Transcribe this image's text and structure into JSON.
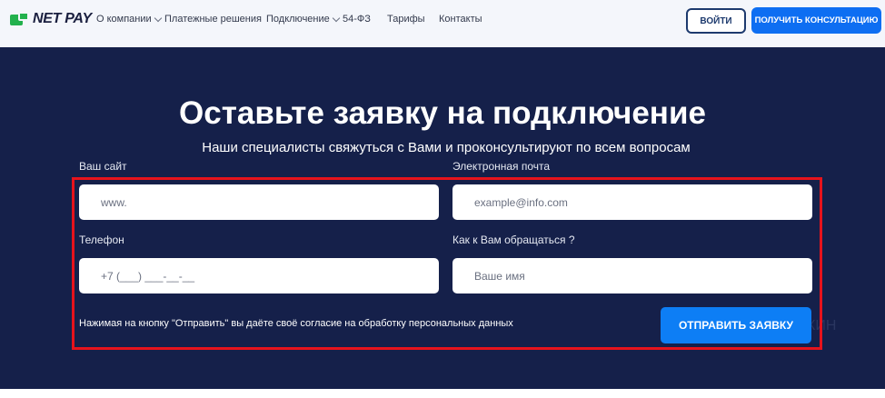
{
  "header": {
    "logo_text": "NET PAY",
    "nav": [
      {
        "label": "О компании",
        "has_dropdown": true
      },
      {
        "label": "Платежные решения",
        "has_dropdown": false
      },
      {
        "label": "Подключение",
        "has_dropdown": true
      },
      {
        "label": "54-ФЗ",
        "has_dropdown": false
      },
      {
        "label": "Тарифы",
        "has_dropdown": false
      },
      {
        "label": "Контакты",
        "has_dropdown": false
      }
    ],
    "login_label": "ВОЙТИ",
    "consult_label": "ПОЛУЧИТЬ КОНСУЛЬТАЦИЮ"
  },
  "form": {
    "title": "Оставьте заявку на подключение",
    "subtitle": "Наши специалисты свяжуться с Вами и проконсультируют по всем вопросам",
    "site_label": "Ваш сайт",
    "site_placeholder": "www.",
    "email_label": "Электронная почта",
    "email_placeholder": "example@info.com",
    "phone_label": "Телефон",
    "phone_placeholder": "+7 (___) ___-__-__",
    "name_label": "Как к Вам обращаться ?",
    "name_placeholder": "Ваше имя",
    "consent_text": "Нажимая на кнопку \"Отправить\" вы даёте своё согласие на обработку персональных данных",
    "submit_label": "ОТПРАВИТЬ ЗАЯВКУ",
    "ghost_text": "КИН"
  },
  "colors": {
    "brand_green": "#23b14d",
    "accent_blue": "#0d6ef2",
    "section_bg": "#15204a",
    "highlight_red": "#e6131c"
  }
}
